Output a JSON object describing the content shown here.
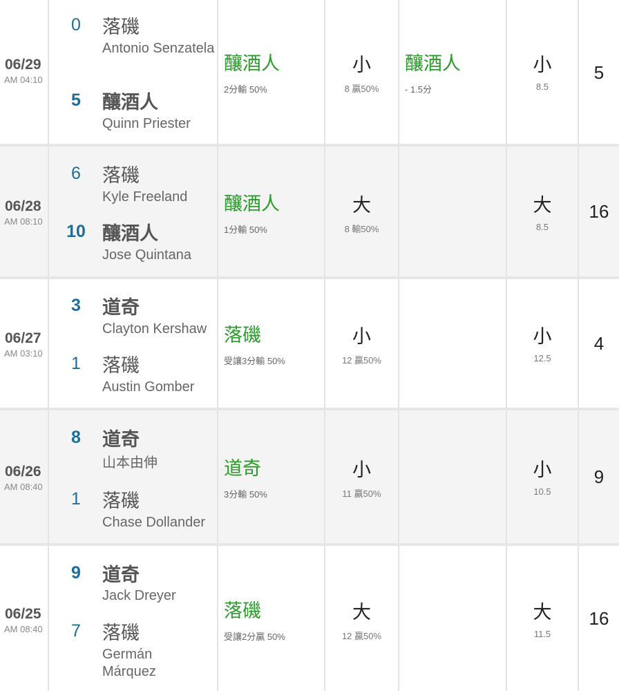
{
  "games": [
    {
      "date": "06/29",
      "time": "AM 04:10",
      "away": {
        "score": "0",
        "team": "落磯",
        "pitcher": "Antonio Senzatela",
        "winner": false
      },
      "home": {
        "score": "5",
        "team": "釀酒人",
        "pitcher": "Quinn Priester",
        "winner": true
      },
      "spread": {
        "pick": "釀酒人",
        "detail": "2分輸 50%"
      },
      "ou": {
        "result": "小",
        "detail": "8  贏50%"
      },
      "spread2": {
        "pick": "釀酒人",
        "detail": "- 1.5分"
      },
      "ou2": {
        "result": "小",
        "line": "8.5"
      },
      "total": "5"
    },
    {
      "date": "06/28",
      "time": "AM 08:10",
      "away": {
        "score": "6",
        "team": "落磯",
        "pitcher": "Kyle Freeland",
        "winner": false
      },
      "home": {
        "score": "10",
        "team": "釀酒人",
        "pitcher": "Jose Quintana",
        "winner": true
      },
      "spread": {
        "pick": "釀酒人",
        "detail": "1分輸 50%"
      },
      "ou": {
        "result": "大",
        "detail": "8  輸50%"
      },
      "spread2": {
        "pick": "",
        "detail": ""
      },
      "ou2": {
        "result": "大",
        "line": "8.5"
      },
      "total": "16"
    },
    {
      "date": "06/27",
      "time": "AM 03:10",
      "away": {
        "score": "3",
        "team": "道奇",
        "pitcher": "Clayton Kershaw",
        "winner": true
      },
      "home": {
        "score": "1",
        "team": "落磯",
        "pitcher": "Austin Gomber",
        "winner": false
      },
      "spread": {
        "pick": "落磯",
        "detail": "受讓3分輸 50%"
      },
      "ou": {
        "result": "小",
        "detail": "12  贏50%"
      },
      "spread2": {
        "pick": "",
        "detail": ""
      },
      "ou2": {
        "result": "小",
        "line": "12.5"
      },
      "total": "4"
    },
    {
      "date": "06/26",
      "time": "AM 08:40",
      "away": {
        "score": "8",
        "team": "道奇",
        "pitcher": "山本由伸",
        "winner": true
      },
      "home": {
        "score": "1",
        "team": "落磯",
        "pitcher": "Chase Dollander",
        "winner": false
      },
      "spread": {
        "pick": "道奇",
        "detail": "3分輸 50%"
      },
      "ou": {
        "result": "小",
        "detail": "11  贏50%"
      },
      "spread2": {
        "pick": "",
        "detail": ""
      },
      "ou2": {
        "result": "小",
        "line": "10.5"
      },
      "total": "9"
    },
    {
      "date": "06/25",
      "time": "AM 08:40",
      "away": {
        "score": "9",
        "team": "道奇",
        "pitcher": "Jack Dreyer",
        "winner": true
      },
      "home": {
        "score": "7",
        "team": "落磯",
        "pitcher": "Germán Márquez",
        "winner": false
      },
      "spread": {
        "pick": "落磯",
        "detail": "受讓2分贏 50%"
      },
      "ou": {
        "result": "大",
        "detail": "12  贏50%"
      },
      "spread2": {
        "pick": "",
        "detail": ""
      },
      "ou2": {
        "result": "大",
        "line": "11.5"
      },
      "total": "16"
    }
  ]
}
